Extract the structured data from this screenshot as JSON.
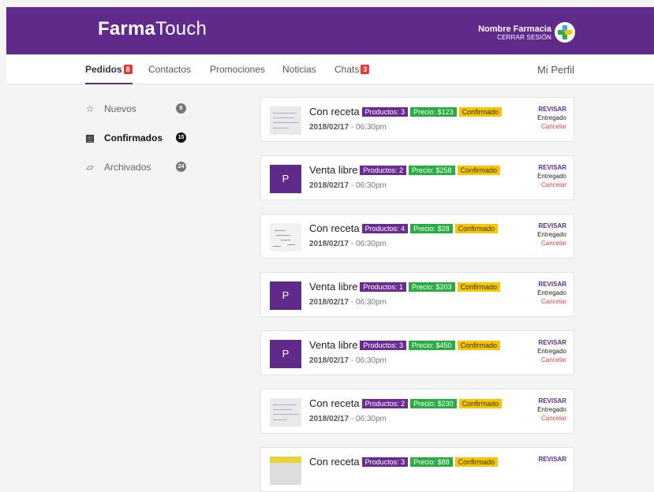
{
  "header": {
    "brand_bold": "Farma",
    "brand_light": "Touch",
    "pharmacy_name": "Nombre Farmacia",
    "logout_label": "CERRAR SESIÓN",
    "logo_icon": "pharmacy-cross-icon"
  },
  "nav": {
    "tabs": [
      {
        "label": "Pedidos",
        "badge": "8"
      },
      {
        "label": "Contactos"
      },
      {
        "label": "Promociones"
      },
      {
        "label": "Noticias"
      },
      {
        "label": "Chats",
        "badge": "3"
      }
    ],
    "profile_label": "Mi Perfil"
  },
  "sidebar": {
    "items": [
      {
        "label": "Nuevos",
        "count": "8",
        "icon": "star-outline-icon"
      },
      {
        "label": "Confirmados",
        "count": "15",
        "icon": "clipboard-icon"
      },
      {
        "label": "Archivados",
        "count": "24",
        "icon": "archive-box-icon"
      }
    ]
  },
  "orders": [
    {
      "title": "Con receta",
      "products": "Productos: 3",
      "price": "Precio: $123",
      "status": "Confirmado",
      "date": "2018/02/17",
      "time": "06:30pm",
      "thumb": "prescription-photo",
      "action_review": "REVISAR",
      "action_delivered": "Entregado",
      "action_cancel": "Cancelar"
    },
    {
      "title": "Venta libre",
      "products": "Productos: 2",
      "price": "Precio: $258",
      "status": "Confirmado",
      "date": "2018/02/17",
      "time": "06:30pm",
      "thumb": "P",
      "action_review": "REVISAR",
      "action_delivered": "Entregado",
      "action_cancel": "Cancelar"
    },
    {
      "title": "Con receta",
      "products": "Productos: 4",
      "price": "Precio: $28",
      "status": "Confirmado",
      "date": "2018/02/17",
      "time": "06:30pm",
      "thumb": "handwritten-note-photo",
      "action_review": "REVISAR",
      "action_delivered": "Entregado",
      "action_cancel": "Cancelar"
    },
    {
      "title": "Venta libre",
      "products": "Productos: 1",
      "price": "Precio: $203",
      "status": "Confirmado",
      "date": "2018/02/17",
      "time": "06:30pm",
      "thumb": "P",
      "action_review": "REVISAR",
      "action_delivered": "Entregado",
      "action_cancel": "Cancelar"
    },
    {
      "title": "Venta libre",
      "products": "Productos: 3",
      "price": "Precio: $450",
      "status": "Confirmado",
      "date": "2018/02/17",
      "time": "06:30pm",
      "thumb": "P",
      "action_review": "REVISAR",
      "action_delivered": "Entregado",
      "action_cancel": "Cancelar"
    },
    {
      "title": "Con receta",
      "products": "Productos: 2",
      "price": "Precio: $230",
      "status": "Confirmado",
      "date": "2018/02/17",
      "time": "06:30pm",
      "thumb": "prescription-photo",
      "action_review": "REVISAR",
      "action_delivered": "Entregado",
      "action_cancel": "Cancelar"
    },
    {
      "title": "Con receta",
      "products": "Productos: 3",
      "price": "Precio: $88",
      "status": "Confirmado",
      "date": "",
      "time": "",
      "thumb": "yellow-prescription-photo",
      "action_review": "REVISAR",
      "action_delivered": "",
      "action_cancel": ""
    }
  ],
  "colors": {
    "brand_purple": "#5f2a8a",
    "products_tag": "#6a2c91",
    "price_tag": "#2bab44",
    "status_tag": "#f6c500",
    "cancel_red": "#e04040",
    "badge_red": "#e53935"
  }
}
